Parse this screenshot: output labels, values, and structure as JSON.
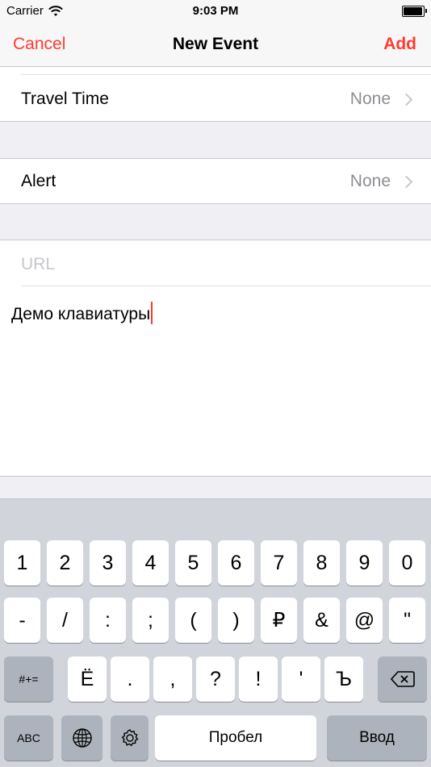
{
  "status_bar": {
    "carrier": "Carrier",
    "time": "9:03 PM"
  },
  "nav": {
    "cancel": "Cancel",
    "title": "New Event",
    "add": "Add"
  },
  "rows": {
    "travel_time": {
      "label": "Travel Time",
      "value": "None"
    },
    "alert": {
      "label": "Alert",
      "value": "None"
    }
  },
  "url_placeholder": "URL",
  "notes_text": "Демо клавиатуры",
  "keyboard": {
    "row1": [
      "1",
      "2",
      "3",
      "4",
      "5",
      "6",
      "7",
      "8",
      "9",
      "0"
    ],
    "row2": [
      "-",
      "/",
      ":",
      ";",
      "(",
      ")",
      "₽",
      "&",
      "@",
      "\""
    ],
    "row3_left": "#+=",
    "row3": [
      "Ё",
      ".",
      ",",
      "?",
      "!",
      "'",
      "Ъ"
    ],
    "abc": "ABC",
    "space": "Пробел",
    "enter": "Ввод"
  },
  "colors": {
    "accent": "#ff3b30",
    "keyboard_bg": "#d1d5db"
  }
}
